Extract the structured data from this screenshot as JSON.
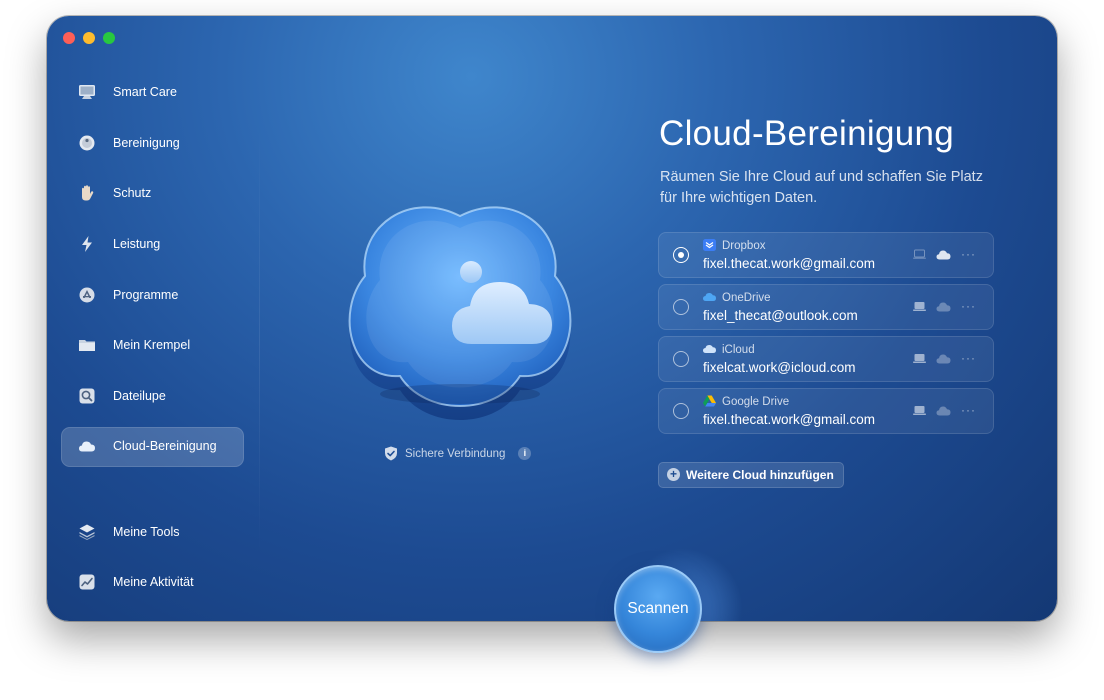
{
  "sidebar": {
    "items": [
      {
        "label": "Smart Care"
      },
      {
        "label": "Bereinigung"
      },
      {
        "label": "Schutz"
      },
      {
        "label": "Leistung"
      },
      {
        "label": "Programme"
      },
      {
        "label": "Mein Krempel"
      },
      {
        "label": "Dateilupe"
      },
      {
        "label": "Cloud-Bereinigung",
        "active": true
      },
      {
        "label": "Meine Tools"
      },
      {
        "label": "Meine Aktivität"
      }
    ]
  },
  "main": {
    "title": "Cloud-Bereinigung",
    "subtitle": "Räumen Sie Ihre Cloud auf und schaffen Sie Platz für Ihre wichtigen Daten.",
    "secure_connection": "Sichere Verbindung",
    "info_glyph": "i",
    "accounts": [
      {
        "service": "Dropbox",
        "email": "fixel.thecat.work@gmail.com",
        "selected": true,
        "icon": "dropbox-icon"
      },
      {
        "service": "OneDrive",
        "email": "fixel_thecat@outlook.com",
        "selected": false,
        "icon": "onedrive-icon"
      },
      {
        "service": "iCloud",
        "email": "fixelcat.work@icloud.com",
        "selected": false,
        "icon": "icloud-icon"
      },
      {
        "service": "Google Drive",
        "email": "fixel.thecat.work@gmail.com",
        "selected": false,
        "icon": "google-drive-icon"
      }
    ],
    "more_glyph": "···",
    "add_cloud_label": "Weitere Cloud hinzufügen",
    "add_glyph": "+",
    "scan_label": "Scannen"
  },
  "colors": {
    "accent": "#3586da",
    "window_top": "#3f86cc",
    "window_bottom": "#143874"
  }
}
